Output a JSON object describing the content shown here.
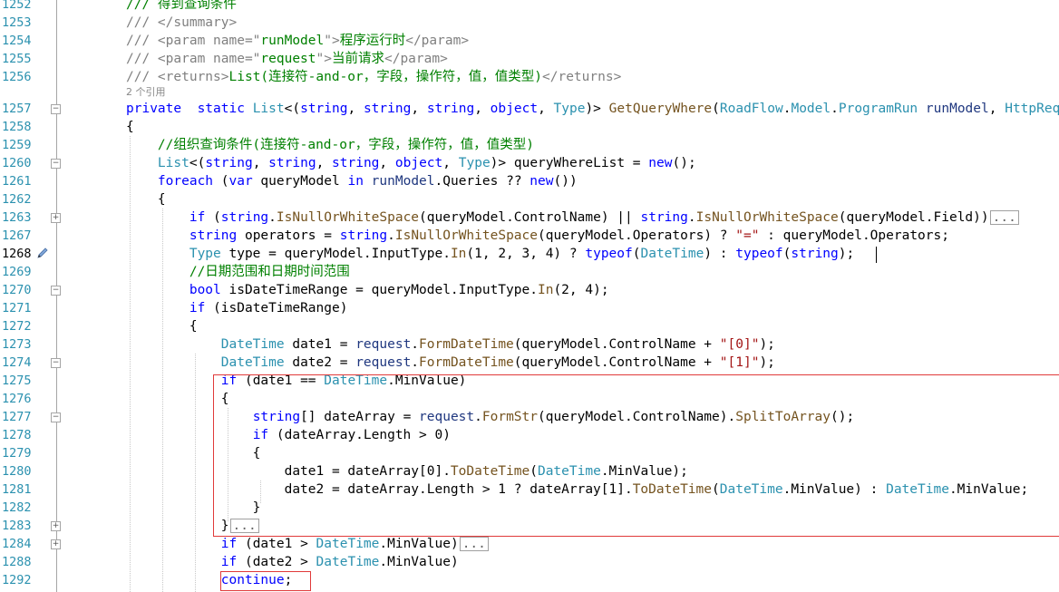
{
  "editor": {
    "refs_label": "2 个引用",
    "lines": [
      {
        "num": "1252",
        "tokens": [
          [
            "cm",
            "/// 得到查询条件"
          ]
        ]
      },
      {
        "num": "1253",
        "tokens": [
          [
            "xg",
            "/// </summary>"
          ]
        ]
      },
      {
        "num": "1254",
        "tokens": [
          [
            "xg",
            "/// <param name=\""
          ],
          [
            "cm",
            "runModel"
          ],
          [
            "xg",
            "\">"
          ],
          [
            "cm",
            "程序运行时"
          ],
          [
            "xg",
            "</param>"
          ]
        ]
      },
      {
        "num": "1255",
        "tokens": [
          [
            "xg",
            "/// <param name=\""
          ],
          [
            "cm",
            "request"
          ],
          [
            "xg",
            "\">"
          ],
          [
            "cm",
            "当前请求"
          ],
          [
            "xg",
            "</param>"
          ]
        ]
      },
      {
        "num": "1256",
        "tokens": [
          [
            "xg",
            "/// <returns>"
          ],
          [
            "cm",
            "List(连接符-and-or，字段，操作符，值，值类型)"
          ],
          [
            "xg",
            "</returns>"
          ]
        ]
      },
      {
        "num": "1257",
        "tokens": [
          [
            "kw",
            "private"
          ],
          [
            "",
            "  "
          ],
          [
            "kw",
            "static"
          ],
          [
            "",
            " "
          ],
          [
            "ty",
            "List"
          ],
          [
            "",
            "<("
          ],
          [
            "kw",
            "string"
          ],
          [
            ", "
          ],
          [
            "kw",
            "string"
          ],
          [
            ", "
          ],
          [
            "kw",
            "string"
          ],
          [
            ", "
          ],
          [
            "kw",
            "object"
          ],
          [
            ", "
          ],
          [
            "ty",
            "Type"
          ],
          [
            ")> "
          ],
          [
            "me",
            "GetQueryWhere"
          ],
          [
            "",
            "("
          ],
          [
            "ty",
            "RoadFlow"
          ],
          [
            "",
            "."
          ],
          [
            "ty",
            "Model"
          ],
          [
            "",
            "."
          ],
          [
            "ty",
            "ProgramRun"
          ],
          [
            "",
            " "
          ],
          [
            "pa",
            "runModel"
          ],
          [
            ", "
          ],
          [
            "ty",
            "HttpRequest"
          ]
        ]
      },
      {
        "num": "1258",
        "tokens": [
          [
            "",
            "{"
          ]
        ]
      },
      {
        "num": "1259",
        "tokens": [
          [
            "cm",
            "    //组织查询条件(连接符-and-or，字段，操作符，值，值类型)"
          ]
        ]
      },
      {
        "num": "1260",
        "tokens": [
          [
            "",
            "    "
          ],
          [
            "ty",
            "List"
          ],
          [
            "",
            "<("
          ],
          [
            "kw",
            "string"
          ],
          [
            ", "
          ],
          [
            "kw",
            "string"
          ],
          [
            ", "
          ],
          [
            "kw",
            "string"
          ],
          [
            ", "
          ],
          [
            "kw",
            "object"
          ],
          [
            ", "
          ],
          [
            "ty",
            "Type"
          ],
          [
            ")> queryWhereList = "
          ],
          [
            "kw",
            "new"
          ],
          [
            "",
            "();"
          ]
        ]
      },
      {
        "num": "1261",
        "tokens": [
          [
            "",
            "    "
          ],
          [
            "kw",
            "foreach"
          ],
          [
            "",
            " ("
          ],
          [
            "kw",
            "var"
          ],
          [
            "",
            " queryModel "
          ],
          [
            "kw",
            "in"
          ],
          [
            "",
            " "
          ],
          [
            "pa",
            "runModel"
          ],
          [
            "",
            ".Queries ?? "
          ],
          [
            "kw",
            "new"
          ],
          [
            "",
            "())"
          ]
        ]
      },
      {
        "num": "1262",
        "tokens": [
          [
            "",
            "    {"
          ]
        ]
      },
      {
        "num": "1263",
        "tokens": [
          [
            "",
            "        "
          ],
          [
            "kw",
            "if"
          ],
          [
            "",
            " ("
          ],
          [
            "kw",
            "string"
          ],
          [
            "",
            "."
          ],
          [
            "me",
            "IsNullOrWhiteSpace"
          ],
          [
            "",
            "(queryModel.ControlName) || "
          ],
          [
            "kw",
            "string"
          ],
          [
            "",
            "."
          ],
          [
            "me",
            "IsNullOrWhiteSpace"
          ],
          [
            "",
            "(queryModel.Field))"
          ]
        ]
      },
      {
        "num": "1267",
        "tokens": [
          [
            "",
            "        "
          ],
          [
            "kw",
            "string"
          ],
          [
            "",
            " operators = "
          ],
          [
            "kw",
            "string"
          ],
          [
            "",
            "."
          ],
          [
            "me",
            "IsNullOrWhiteSpace"
          ],
          [
            "",
            "(queryModel.Operators) ? "
          ],
          [
            "st",
            "\"=\""
          ],
          [
            "",
            " : queryModel.Operators;"
          ]
        ]
      },
      {
        "num": "1268",
        "tokens": [
          [
            "",
            "        "
          ],
          [
            "ty",
            "Type"
          ],
          [
            "",
            " type = queryModel.InputType."
          ],
          [
            "me",
            "In"
          ],
          [
            "",
            "(1, 2, 3, 4) ? "
          ],
          [
            "kw",
            "typeof"
          ],
          [
            "",
            "("
          ],
          [
            "ty",
            "DateTime"
          ],
          [
            "",
            ") : "
          ],
          [
            "kw",
            "typeof"
          ],
          [
            "",
            "("
          ],
          [
            "kw",
            "string"
          ],
          [
            "",
            ");"
          ]
        ]
      },
      {
        "num": "1269",
        "tokens": [
          [
            "cm",
            "        //日期范围和日期时间范围"
          ]
        ]
      },
      {
        "num": "1270",
        "tokens": [
          [
            "",
            "        "
          ],
          [
            "kw",
            "bool"
          ],
          [
            "",
            " isDateTimeRange = queryModel.InputType."
          ],
          [
            "me",
            "In"
          ],
          [
            "",
            "(2, 4);"
          ]
        ]
      },
      {
        "num": "1271",
        "tokens": [
          [
            "",
            "        "
          ],
          [
            "kw",
            "if"
          ],
          [
            "",
            " (isDateTimeRange)"
          ]
        ]
      },
      {
        "num": "1272",
        "tokens": [
          [
            "",
            "        {"
          ]
        ]
      },
      {
        "num": "1273",
        "tokens": [
          [
            "",
            "            "
          ],
          [
            "ty",
            "DateTime"
          ],
          [
            "",
            " date1 = "
          ],
          [
            "pa",
            "request"
          ],
          [
            "",
            "."
          ],
          [
            "me",
            "FormDateTime"
          ],
          [
            "",
            "(queryModel.ControlName + "
          ],
          [
            "st",
            "\"[0]\""
          ],
          [
            "",
            ");"
          ]
        ]
      },
      {
        "num": "1274",
        "tokens": [
          [
            "",
            "            "
          ],
          [
            "ty",
            "DateTime"
          ],
          [
            "",
            " date2 = "
          ],
          [
            "pa",
            "request"
          ],
          [
            "",
            "."
          ],
          [
            "me",
            "FormDateTime"
          ],
          [
            "",
            "(queryModel.ControlName + "
          ],
          [
            "st",
            "\"[1]\""
          ],
          [
            "",
            ");"
          ]
        ]
      },
      {
        "num": "1275",
        "tokens": [
          [
            "",
            "            "
          ],
          [
            "kw",
            "if"
          ],
          [
            "",
            " (date1 == "
          ],
          [
            "ty",
            "DateTime"
          ],
          [
            "",
            ".MinValue)"
          ]
        ]
      },
      {
        "num": "1276",
        "tokens": [
          [
            "",
            "            {"
          ]
        ]
      },
      {
        "num": "1277",
        "tokens": [
          [
            "",
            "                "
          ],
          [
            "kw",
            "string"
          ],
          [
            "",
            "[] dateArray = "
          ],
          [
            "pa",
            "request"
          ],
          [
            "",
            "."
          ],
          [
            "me",
            "FormStr"
          ],
          [
            "",
            "(queryModel.ControlName)."
          ],
          [
            "me",
            "SplitToArray"
          ],
          [
            "",
            "();"
          ]
        ]
      },
      {
        "num": "1278",
        "tokens": [
          [
            "",
            "                "
          ],
          [
            "kw",
            "if"
          ],
          [
            "",
            " (dateArray.Length > 0)"
          ]
        ]
      },
      {
        "num": "1279",
        "tokens": [
          [
            "",
            "                {"
          ]
        ]
      },
      {
        "num": "1280",
        "tokens": [
          [
            "",
            "                    date1 = dateArray[0]."
          ],
          [
            "me",
            "ToDateTime"
          ],
          [
            "",
            "("
          ],
          [
            "ty",
            "DateTime"
          ],
          [
            "",
            ".MinValue);"
          ]
        ]
      },
      {
        "num": "1281",
        "tokens": [
          [
            "",
            "                    date2 = dateArray.Length > 1 ? dateArray[1]."
          ],
          [
            "me",
            "ToDateTime"
          ],
          [
            "",
            "("
          ],
          [
            "ty",
            "DateTime"
          ],
          [
            "",
            ".MinValue) : "
          ],
          [
            "ty",
            "DateTime"
          ],
          [
            "",
            ".MinValue;"
          ]
        ]
      },
      {
        "num": "1282",
        "tokens": [
          [
            "",
            "                }"
          ]
        ]
      },
      {
        "num": "1283",
        "tokens": [
          [
            "",
            "            }"
          ]
        ]
      },
      {
        "num": "1284",
        "tokens": [
          [
            "",
            "            "
          ],
          [
            "kw",
            "if"
          ],
          [
            "",
            " (date1 > "
          ],
          [
            "ty",
            "DateTime"
          ],
          [
            "",
            ".MinValue)"
          ]
        ]
      },
      {
        "num": "1288",
        "tokens": [
          [
            "",
            "            "
          ],
          [
            "kw",
            "if"
          ],
          [
            "",
            " (date2 > "
          ],
          [
            "ty",
            "DateTime"
          ],
          [
            "",
            ".MinValue)"
          ]
        ]
      },
      {
        "num": "1292",
        "tokens": [
          [
            "",
            "            "
          ],
          [
            "kw",
            "continue"
          ],
          [
            "",
            ";"
          ]
        ]
      }
    ],
    "collapsed_label": "...",
    "fold_minus": "−",
    "fold_plus": "+"
  },
  "colors": {
    "line_number": "#2B91AF",
    "keyword": "#0000FF",
    "type": "#2B91AF",
    "comment": "#008000",
    "xml_doc": "#808080",
    "string": "#A31515",
    "method": "#74531F",
    "highlight_box": "#E03A3A"
  }
}
